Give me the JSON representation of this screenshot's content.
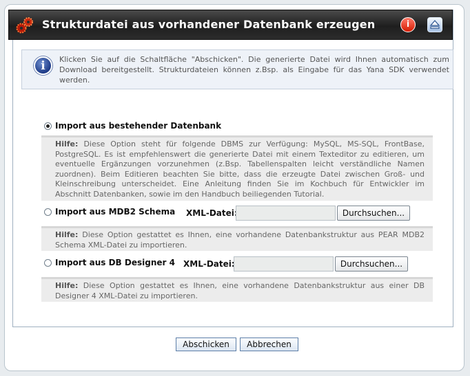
{
  "header": {
    "title": "Strukturdatei aus vorhandener Datenbank erzeugen",
    "help_icon_glyph": "i",
    "logo_icon": "gears-icon",
    "up_icon": "eject-up-icon"
  },
  "info": {
    "icon_glyph": "i",
    "text": "Klicken Sie auf die Schaltfläche \"Abschicken\". Die generierte Datei wird Ihnen automatisch zum Download bereitgestellt. Strukturdateien können z.Bsp. als Eingabe für das Yana SDK verwendet werden."
  },
  "options": [
    {
      "label": "Import aus bestehender Datenbank",
      "selected": true,
      "hint_label": "Hilfe:",
      "hint_text": "Diese Option steht für folgende DBMS zur Verfügung: MySQL, MS-SQL, FrontBase, PostgreSQL. Es ist empfehlenswert die generierte Datei mit einem Texteditor zu editieren, um eventuelle Ergänzungen vorzunehmen (z.Bsp. Tabellenspalten leicht verständliche Namen zuordnen). Beim Editieren beachten Sie bitte, dass die erzeugte Datei zwischen Groß- und Kleinschreibung unterscheidet. Eine Anleitung finden Sie im Kochbuch für Entwickler im Abschnitt Datenbanken, sowie im den Handbuch beiliegenden Tutorial."
    },
    {
      "label": "Import aus MDB2 Schema",
      "selected": false,
      "file_label": "XML-Datei:",
      "file_value": "",
      "browse_label": "Durchsuchen...",
      "hint_label": "Hilfe:",
      "hint_text": "Diese Option gestattet es Ihnen, eine vorhandene Datenbankstruktur aus PEAR MDB2 Schema XML-Datei zu importieren."
    },
    {
      "label": "Import aus DB Designer 4",
      "selected": false,
      "file_label": "XML-Datei:",
      "file_value": "",
      "browse_label": "Durchsuchen...",
      "hint_label": "Hilfe:",
      "hint_text": "Diese Option gestattet es Ihnen, eine vorhandene Datenbankstruktur aus einer DB Designer 4 XML-Datei zu importieren."
    }
  ],
  "actions": {
    "submit_label": "Abschicken",
    "cancel_label": "Abbrechen"
  }
}
